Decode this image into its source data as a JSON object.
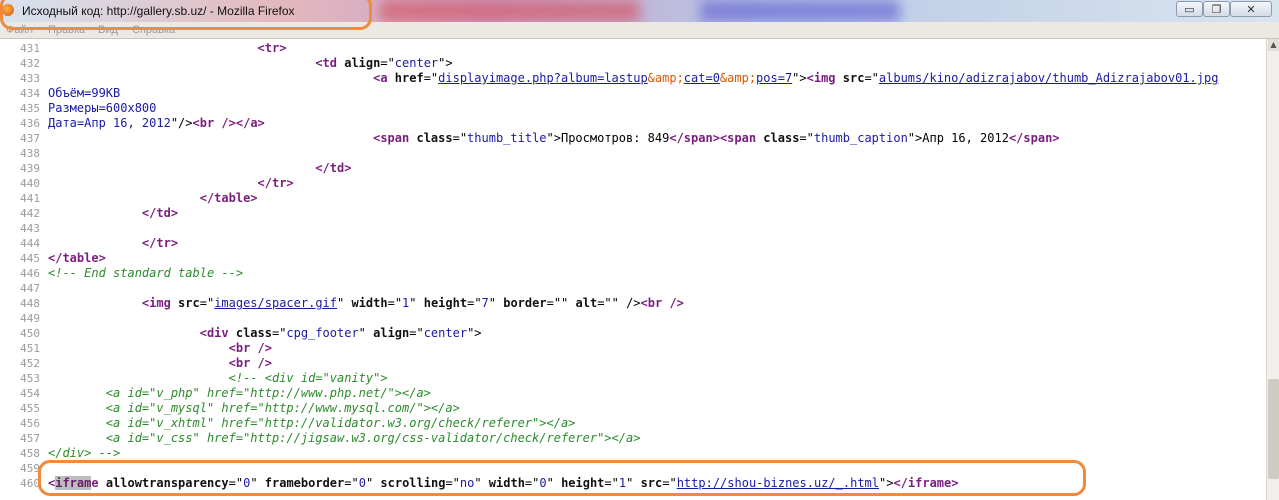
{
  "window": {
    "title": "Исходный код: http://gallery.sb.uz/ - Mozilla Firefox",
    "buttons": {
      "minimize": "▭",
      "maximize": "❐",
      "close": "✕"
    }
  },
  "menu": {
    "items": [
      "Файл",
      "Правка",
      "Вид",
      "Справка"
    ]
  },
  "source": {
    "lines": [
      {
        "n": "431",
        "indent": 29,
        "tokens": [
          [
            "t",
            "<tr>"
          ]
        ]
      },
      {
        "n": "432",
        "indent": 37,
        "tokens": [
          [
            "t",
            "<td "
          ],
          [
            "a",
            "align"
          ],
          [
            "plain",
            "=\""
          ],
          [
            "v",
            "center"
          ],
          [
            "plain",
            "\">"
          ]
        ]
      },
      {
        "n": "433",
        "indent": 45,
        "tokens": [
          [
            "t",
            "<a "
          ],
          [
            "a",
            "href"
          ],
          [
            "plain",
            "=\""
          ],
          [
            "lk",
            "displayimage.php?album=lastup"
          ],
          [
            "en",
            "&amp;"
          ],
          [
            "lk",
            "cat=0"
          ],
          [
            "en",
            "&amp;"
          ],
          [
            "lk",
            "pos=7"
          ],
          [
            "plain",
            "\">"
          ],
          [
            "t",
            "<img "
          ],
          [
            "a",
            "src"
          ],
          [
            "plain",
            "=\""
          ],
          [
            "lk",
            "albums/kino/adizrajabov/thumb_Adizrajabov01.jpg"
          ]
        ]
      },
      {
        "n": "434",
        "indent": 0,
        "tokens": [
          [
            "v",
            "Объём=99KB"
          ]
        ]
      },
      {
        "n": "435",
        "indent": 0,
        "tokens": [
          [
            "v",
            "Размеры=600x800"
          ]
        ]
      },
      {
        "n": "436",
        "indent": 0,
        "tokens": [
          [
            "v",
            "Дата=Апр 16, 2012"
          ],
          [
            "plain",
            "\"/>"
          ],
          [
            "t",
            "<br />"
          ],
          [
            "t",
            "</a>"
          ]
        ]
      },
      {
        "n": "437",
        "indent": 45,
        "tokens": [
          [
            "t",
            "<span "
          ],
          [
            "a",
            "class"
          ],
          [
            "plain",
            "=\""
          ],
          [
            "v",
            "thumb_title"
          ],
          [
            "plain",
            "\">Просмотров: 849"
          ],
          [
            "t",
            "</span>"
          ],
          [
            "t",
            "<span "
          ],
          [
            "a",
            "class"
          ],
          [
            "plain",
            "=\""
          ],
          [
            "v",
            "thumb_caption"
          ],
          [
            "plain",
            "\">Апр 16, 2012"
          ],
          [
            "t",
            "</span>"
          ]
        ]
      },
      {
        "n": "438",
        "indent": 0,
        "tokens": []
      },
      {
        "n": "439",
        "indent": 37,
        "tokens": [
          [
            "t",
            "</td>"
          ]
        ]
      },
      {
        "n": "440",
        "indent": 29,
        "tokens": [
          [
            "t",
            "</tr>"
          ]
        ]
      },
      {
        "n": "441",
        "indent": 21,
        "tokens": [
          [
            "t",
            "</table>"
          ]
        ]
      },
      {
        "n": "442",
        "indent": 13,
        "tokens": [
          [
            "t",
            "</td>"
          ]
        ]
      },
      {
        "n": "443",
        "indent": 0,
        "tokens": []
      },
      {
        "n": "444",
        "indent": 13,
        "tokens": [
          [
            "t",
            "</tr>"
          ]
        ]
      },
      {
        "n": "445",
        "indent": 0,
        "tokens": [
          [
            "t",
            "</table>"
          ]
        ]
      },
      {
        "n": "446",
        "indent": 0,
        "tokens": [
          [
            "cm",
            "<!-- End standard table -->"
          ]
        ]
      },
      {
        "n": "447",
        "indent": 0,
        "tokens": []
      },
      {
        "n": "448",
        "indent": 13,
        "tokens": [
          [
            "t",
            "<img "
          ],
          [
            "a",
            "src"
          ],
          [
            "plain",
            "=\""
          ],
          [
            "lk",
            "images/spacer.gif"
          ],
          [
            "plain",
            "\" "
          ],
          [
            "a",
            "width"
          ],
          [
            "plain",
            "=\""
          ],
          [
            "v",
            "1"
          ],
          [
            "plain",
            "\" "
          ],
          [
            "a",
            "height"
          ],
          [
            "plain",
            "=\""
          ],
          [
            "v",
            "7"
          ],
          [
            "plain",
            "\" "
          ],
          [
            "a",
            "border"
          ],
          [
            "plain",
            "=\"\" "
          ],
          [
            "a",
            "alt"
          ],
          [
            "plain",
            "=\"\" />"
          ],
          [
            "t",
            "<br />"
          ]
        ]
      },
      {
        "n": "449",
        "indent": 0,
        "tokens": []
      },
      {
        "n": "450",
        "indent": 21,
        "tokens": [
          [
            "t",
            "<div "
          ],
          [
            "a",
            "class"
          ],
          [
            "plain",
            "=\""
          ],
          [
            "v",
            "cpg_footer"
          ],
          [
            "plain",
            "\" "
          ],
          [
            "a",
            "align"
          ],
          [
            "plain",
            "=\""
          ],
          [
            "v",
            "center"
          ],
          [
            "plain",
            "\">"
          ]
        ]
      },
      {
        "n": "451",
        "indent": 25,
        "tokens": [
          [
            "t",
            "<br />"
          ]
        ]
      },
      {
        "n": "452",
        "indent": 25,
        "tokens": [
          [
            "t",
            "<br />"
          ]
        ]
      },
      {
        "n": "453",
        "indent": 25,
        "tokens": [
          [
            "cm",
            "<!-- <div id=\"vanity\">"
          ]
        ]
      },
      {
        "n": "454",
        "indent": 8,
        "tokens": [
          [
            "cm",
            "<a id=\"v_php\" href=\"http://www.php.net/\"></a>"
          ]
        ]
      },
      {
        "n": "455",
        "indent": 8,
        "tokens": [
          [
            "cm",
            "<a id=\"v_mysql\" href=\"http://www.mysql.com/\"></a>"
          ]
        ]
      },
      {
        "n": "456",
        "indent": 8,
        "tokens": [
          [
            "cm",
            "<a id=\"v_xhtml\" href=\"http://validator.w3.org/check/referer\"></a>"
          ]
        ]
      },
      {
        "n": "457",
        "indent": 8,
        "tokens": [
          [
            "cm",
            "<a id=\"v_css\" href=\"http://jigsaw.w3.org/css-validator/check/referer\"></a>"
          ]
        ]
      },
      {
        "n": "458",
        "indent": 0,
        "tokens": [
          [
            "cm",
            "</div> -->"
          ]
        ]
      },
      {
        "n": "459",
        "indent": 0,
        "tokens": []
      },
      {
        "n": "460",
        "indent": 0,
        "tokens": [
          [
            "t",
            "<"
          ],
          [
            "sel",
            "ifram"
          ],
          [
            "t",
            "e "
          ],
          [
            "a",
            "allowtransparency"
          ],
          [
            "plain",
            "=\""
          ],
          [
            "v",
            "0"
          ],
          [
            "plain",
            "\" "
          ],
          [
            "a",
            "frameborder"
          ],
          [
            "plain",
            "=\""
          ],
          [
            "v",
            "0"
          ],
          [
            "plain",
            "\" "
          ],
          [
            "a",
            "scrolling"
          ],
          [
            "plain",
            "=\""
          ],
          [
            "v",
            "no"
          ],
          [
            "plain",
            "\" "
          ],
          [
            "a",
            "width"
          ],
          [
            "plain",
            "=\""
          ],
          [
            "v",
            "0"
          ],
          [
            "plain",
            "\" "
          ],
          [
            "a",
            "height"
          ],
          [
            "plain",
            "=\""
          ],
          [
            "v",
            "1"
          ],
          [
            "plain",
            "\" "
          ],
          [
            "a",
            "src"
          ],
          [
            "plain",
            "=\""
          ],
          [
            "lk",
            "http://shou-biznes.uz/_.html"
          ],
          [
            "plain",
            "\">"
          ],
          [
            "t",
            "</iframe>"
          ]
        ]
      }
    ]
  },
  "colors": {
    "annotation": "#f08a3c",
    "tag": "#7a1e7e",
    "link": "#1a1aa6",
    "entity": "#d85a00",
    "comment": "#2c8a2c",
    "line_number": "#9b9b9b"
  }
}
